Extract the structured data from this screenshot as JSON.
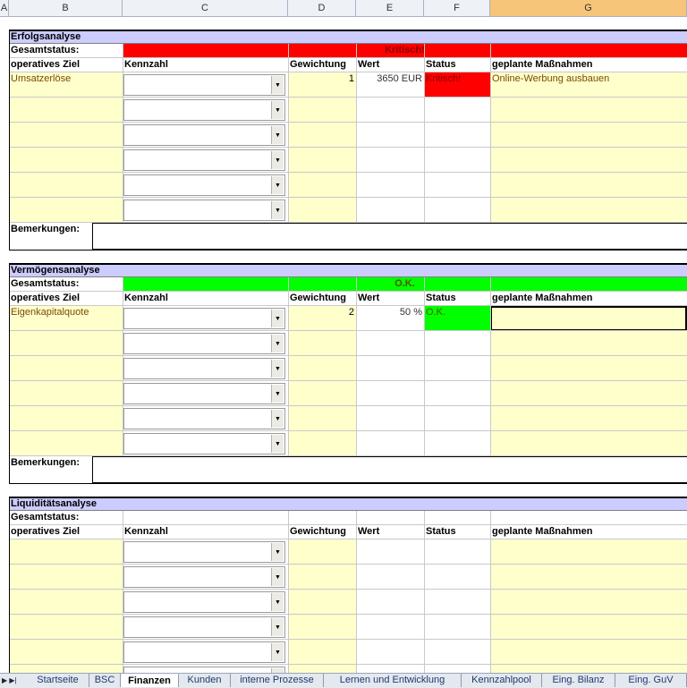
{
  "columns": [
    "A",
    "B",
    "C",
    "D",
    "E",
    "F",
    "G"
  ],
  "sections": [
    {
      "title": "Erfolgsanalyse",
      "gesamtstatus_label": "Gesamtstatus:",
      "gesamtstatus_value": "Kritisch!",
      "gesamtstatus_color": "#ff0000",
      "headers": [
        "operatives Ziel",
        "Kennzahl",
        "Gewichtung",
        "Wert",
        "Status",
        "geplante Maßnahmen"
      ],
      "rows": [
        {
          "ziel": "Umsatzerlöse",
          "kennzahl": "",
          "gewichtung": "1",
          "wert": "3650 EUR",
          "status": "Kritisch!",
          "status_color": "#ff0000",
          "massnahmen": "Online-Werbung ausbauen"
        },
        {
          "ziel": "",
          "kennzahl": "",
          "gewichtung": "",
          "wert": "",
          "status": "",
          "massnahmen": ""
        },
        {
          "ziel": "",
          "kennzahl": "",
          "gewichtung": "",
          "wert": "",
          "status": "",
          "massnahmen": ""
        },
        {
          "ziel": "",
          "kennzahl": "",
          "gewichtung": "",
          "wert": "",
          "status": "",
          "massnahmen": ""
        },
        {
          "ziel": "",
          "kennzahl": "",
          "gewichtung": "",
          "wert": "",
          "status": "",
          "massnahmen": ""
        },
        {
          "ziel": "",
          "kennzahl": "",
          "gewichtung": "",
          "wert": "",
          "status": "",
          "massnahmen": ""
        }
      ],
      "bemerkungen_label": "Bemerkungen:"
    },
    {
      "title": "Vermögensanalyse",
      "gesamtstatus_label": "Gesamtstatus:",
      "gesamtstatus_value": "O.K.",
      "gesamtstatus_color": "#00ff00",
      "headers": [
        "operatives Ziel",
        "Kennzahl",
        "Gewichtung",
        "Wert",
        "Status",
        "geplante Maßnahmen"
      ],
      "rows": [
        {
          "ziel": "Eigenkapitalquote",
          "kennzahl": "",
          "gewichtung": "2",
          "wert": "50 %",
          "status": "O.K.",
          "status_color": "#00ff00",
          "massnahmen": ""
        },
        {
          "ziel": "",
          "kennzahl": "",
          "gewichtung": "",
          "wert": "",
          "status": "",
          "massnahmen": ""
        },
        {
          "ziel": "",
          "kennzahl": "",
          "gewichtung": "",
          "wert": "",
          "status": "",
          "massnahmen": ""
        },
        {
          "ziel": "",
          "kennzahl": "",
          "gewichtung": "",
          "wert": "",
          "status": "",
          "massnahmen": ""
        },
        {
          "ziel": "",
          "kennzahl": "",
          "gewichtung": "",
          "wert": "",
          "status": "",
          "massnahmen": ""
        },
        {
          "ziel": "",
          "kennzahl": "",
          "gewichtung": "",
          "wert": "",
          "status": "",
          "massnahmen": ""
        }
      ],
      "bemerkungen_label": "Bemerkungen:"
    },
    {
      "title": "Liquiditätsanalyse",
      "gesamtstatus_label": "Gesamtstatus:",
      "gesamtstatus_value": "",
      "gesamtstatus_color": "",
      "headers": [
        "operatives Ziel",
        "Kennzahl",
        "Gewichtung",
        "Wert",
        "Status",
        "geplante Maßnahmen"
      ],
      "rows": [
        {
          "ziel": "",
          "kennzahl": "",
          "gewichtung": "",
          "wert": "",
          "status": "",
          "massnahmen": ""
        },
        {
          "ziel": "",
          "kennzahl": "",
          "gewichtung": "",
          "wert": "",
          "status": "",
          "massnahmen": ""
        },
        {
          "ziel": "",
          "kennzahl": "",
          "gewichtung": "",
          "wert": "",
          "status": "",
          "massnahmen": ""
        },
        {
          "ziel": "",
          "kennzahl": "",
          "gewichtung": "",
          "wert": "",
          "status": "",
          "massnahmen": ""
        },
        {
          "ziel": "",
          "kennzahl": "",
          "gewichtung": "",
          "wert": "",
          "status": "",
          "massnahmen": ""
        },
        {
          "ziel": "",
          "kennzahl": "",
          "gewichtung": "",
          "wert": "",
          "status": "",
          "massnahmen": ""
        }
      ],
      "bemerkungen_label": ""
    }
  ],
  "tabs": [
    "Startseite",
    "BSC",
    "Finanzen",
    "Kunden",
    "interne Prozesse",
    "Lernen und Entwicklung",
    "Kennzahlpool",
    "Eing. Bilanz",
    "Eing. GuV"
  ],
  "active_tab": "Finanzen",
  "icons": {
    "dropdown": "dropdown-arrow-icon",
    "nav": "sheet-nav-icon"
  }
}
